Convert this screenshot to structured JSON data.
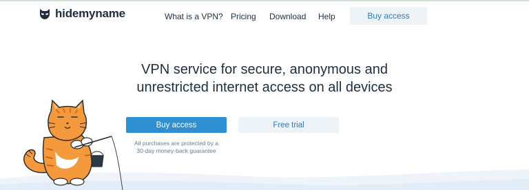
{
  "brand": {
    "name": "hidemyname",
    "accent": "#2f8fd3",
    "text_color": "#1f2d3d",
    "logo_icon": "spy-mask-logo-icon"
  },
  "nav": {
    "items": [
      "What is a VPN?",
      "Pricing",
      "Download",
      "Help"
    ],
    "buy_label": "Buy access"
  },
  "hero": {
    "title_line1": "VPN service for secure, anonymous and",
    "title_line2": "unrestricted internet access on all devices",
    "primary_label": "Buy access",
    "secondary_label": "Free trial",
    "guarantee_line1": "All purchases are protected by a",
    "guarantee_line2": "30-day money-back guarantee",
    "illustration": "fishing-cat-illustration"
  }
}
